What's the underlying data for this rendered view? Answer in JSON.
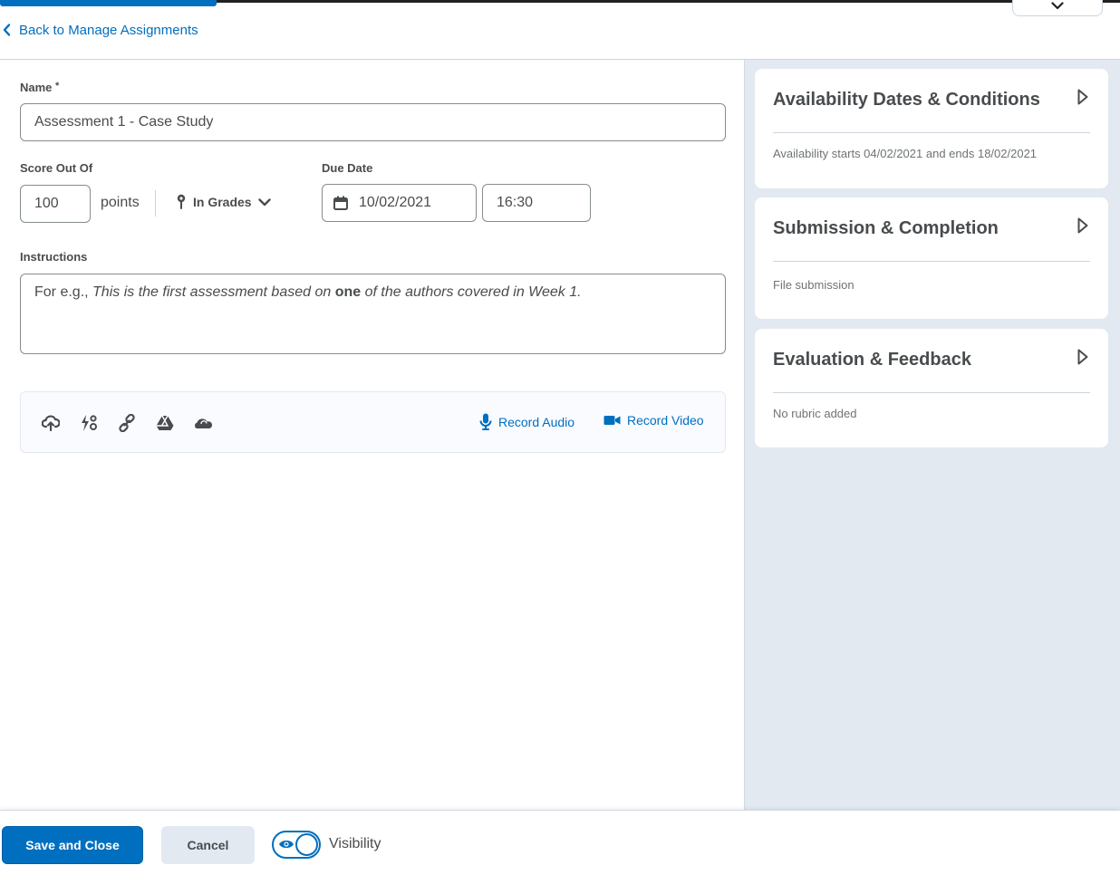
{
  "nav": {
    "back_label": "Back to Manage Assignments"
  },
  "form": {
    "name_label": "Name",
    "name_required_marker": "*",
    "name_value": "Assessment 1 - Case Study",
    "score_label": "Score Out Of",
    "score_value": "100",
    "points_label": "points",
    "grades_label": "In Grades",
    "due_label": "Due Date",
    "due_date_value": "10/02/2021",
    "due_time_value": "16:30",
    "instructions_label": "Instructions",
    "instructions": {
      "prefix": "For e.g.,",
      "italic_1": "This is the first assessment based on",
      "bold": "one",
      "italic_2": "of the authors covered in Week 1."
    }
  },
  "attachments": {
    "icons": [
      "upload-icon",
      "quicklink-icon",
      "link-icon",
      "google-drive-icon",
      "onedrive-icon"
    ],
    "record_audio_label": "Record Audio",
    "record_video_label": "Record Video"
  },
  "sidebar": {
    "panels": [
      {
        "title": "Availability Dates & Conditions",
        "summary": "Availability starts 04/02/2021 and ends 18/02/2021"
      },
      {
        "title": "Submission & Completion",
        "summary": "File submission"
      },
      {
        "title": "Evaluation & Feedback",
        "summary": "No rubric added"
      }
    ]
  },
  "footer": {
    "save_label": "Save and Close",
    "cancel_label": "Cancel",
    "visibility_label": "Visibility",
    "visibility_on": true
  },
  "colors": {
    "accent": "#006fbf",
    "sidebar_bg": "#e3e9f1",
    "text": "#494c4e"
  }
}
